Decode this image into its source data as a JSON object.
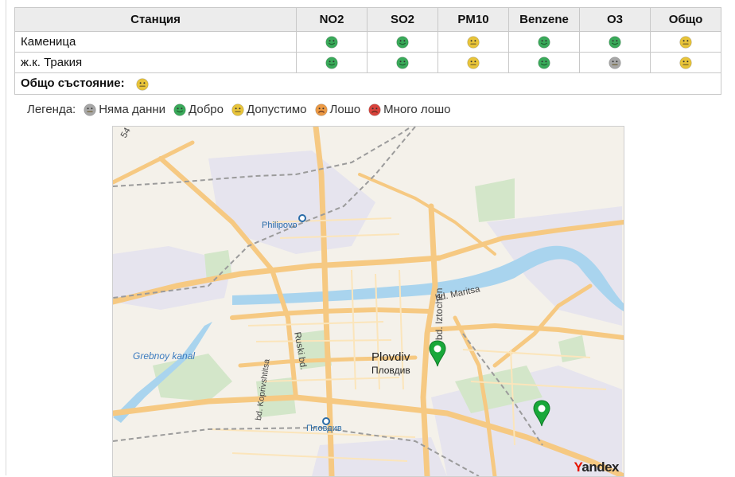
{
  "table": {
    "headers": [
      "Станция",
      "NO2",
      "SO2",
      "PM10",
      "Benzene",
      "O3",
      "Общо"
    ],
    "rows": [
      {
        "station": "Каменица",
        "levels": [
          "good",
          "good",
          "acceptable",
          "good",
          "good",
          "acceptable"
        ]
      },
      {
        "station": "ж.к. Тракия",
        "levels": [
          "good",
          "good",
          "acceptable",
          "good",
          "nodata",
          "acceptable"
        ]
      }
    ],
    "overall_label": "Общо състояние:",
    "overall_level": "acceptable"
  },
  "legend": {
    "title": "Легенда:",
    "items": [
      {
        "level": "nodata",
        "label": "Няма данни"
      },
      {
        "level": "good",
        "label": "Добро"
      },
      {
        "level": "acceptable",
        "label": "Допустимо"
      },
      {
        "level": "bad",
        "label": "Лошо"
      },
      {
        "level": "verybad",
        "label": "Много лошо"
      }
    ]
  },
  "colors": {
    "nodata": "#a7a7a7",
    "good": "#3aaa5a",
    "acceptable": "#e8c43a",
    "bad": "#ec9a45",
    "verybad": "#d9433c",
    "road": "#f6c982",
    "water": "#a9d4ee",
    "pin": "#19a83a"
  },
  "map": {
    "labels": {
      "philipovo": "Philipovo",
      "maritsa": "bd. Maritsa",
      "grebnoy": "Grebnoy kanal",
      "ruski": "Ruski bd.",
      "iztochen": "bd. Iztochen",
      "city_en": "Plovdiv",
      "city_bg": "Пловдив",
      "koprivshtitsa": "bd. Koprivshtitsa",
      "station_bg": "Пловдив",
      "road54": "54"
    },
    "attribution": {
      "y": "Y",
      "rest": "andex"
    }
  }
}
